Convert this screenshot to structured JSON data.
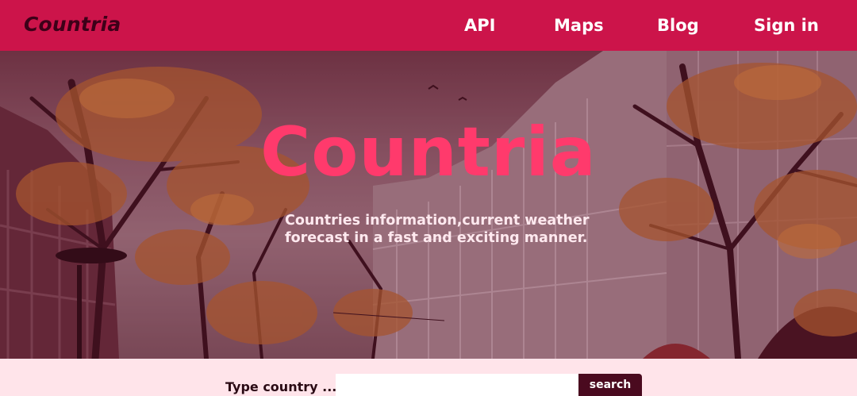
{
  "header": {
    "brand": "Countria",
    "nav": [
      {
        "label": "API"
      },
      {
        "label": "Maps"
      },
      {
        "label": "Blog"
      },
      {
        "label": "Sign in"
      }
    ]
  },
  "hero": {
    "title": "Countria",
    "subtitle": "Countries information,current weather forecast in a fast and exciting manner."
  },
  "search": {
    "label": "Type country ...",
    "input_value": "",
    "button_label": "search"
  },
  "colors": {
    "navbar": "#cc144a",
    "brand": "#3d0018",
    "hero_title": "#ff3a6c",
    "search_button": "#4a0a1f",
    "page_background": "#ffe4ea"
  }
}
